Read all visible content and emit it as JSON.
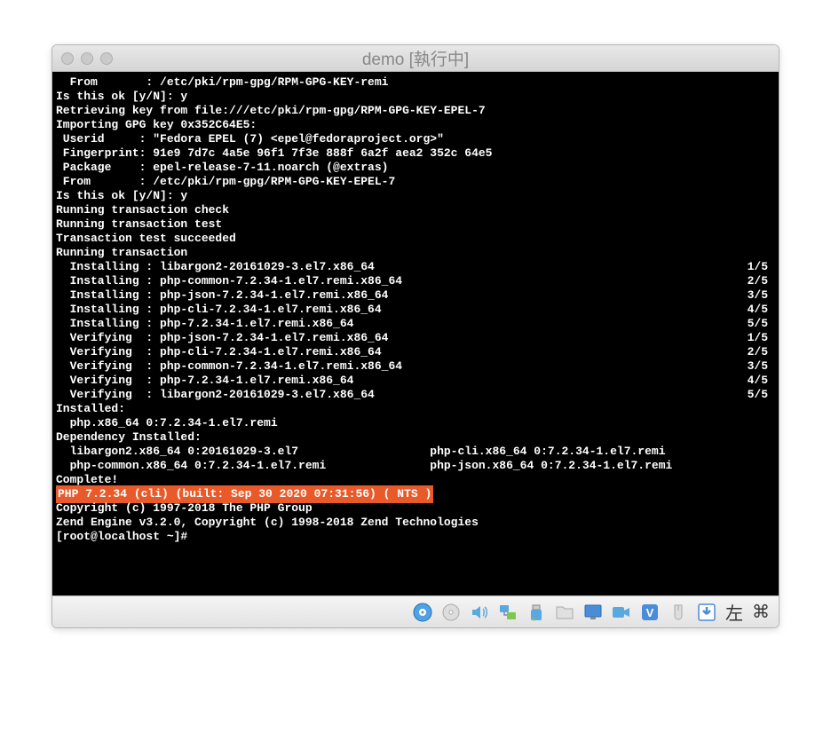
{
  "window": {
    "title": "demo [執行中]"
  },
  "terminal": {
    "lines": [
      {
        "left": "  From       : /etc/pki/rpm-gpg/RPM-GPG-KEY-remi",
        "right": ""
      },
      {
        "left": "Is this ok [y/N]: y",
        "right": ""
      },
      {
        "left": "Retrieving key from file:///etc/pki/rpm-gpg/RPM-GPG-KEY-EPEL-7",
        "right": ""
      },
      {
        "left": "Importing GPG key 0x352C64E5:",
        "right": ""
      },
      {
        "left": " Userid     : \"Fedora EPEL (7) <epel@fedoraproject.org>\"",
        "right": ""
      },
      {
        "left": " Fingerprint: 91e9 7d7c 4a5e 96f1 7f3e 888f 6a2f aea2 352c 64e5",
        "right": ""
      },
      {
        "left": " Package    : epel-release-7-11.noarch (@extras)",
        "right": ""
      },
      {
        "left": " From       : /etc/pki/rpm-gpg/RPM-GPG-KEY-EPEL-7",
        "right": ""
      },
      {
        "left": "Is this ok [y/N]: y",
        "right": ""
      },
      {
        "left": "Running transaction check",
        "right": ""
      },
      {
        "left": "Running transaction test",
        "right": ""
      },
      {
        "left": "Transaction test succeeded",
        "right": ""
      },
      {
        "left": "Running transaction",
        "right": ""
      },
      {
        "left": "  Installing : libargon2-20161029-3.el7.x86_64",
        "right": "1/5"
      },
      {
        "left": "  Installing : php-common-7.2.34-1.el7.remi.x86_64",
        "right": "2/5"
      },
      {
        "left": "  Installing : php-json-7.2.34-1.el7.remi.x86_64",
        "right": "3/5"
      },
      {
        "left": "  Installing : php-cli-7.2.34-1.el7.remi.x86_64",
        "right": "4/5"
      },
      {
        "left": "  Installing : php-7.2.34-1.el7.remi.x86_64",
        "right": "5/5"
      },
      {
        "left": "  Verifying  : php-json-7.2.34-1.el7.remi.x86_64",
        "right": "1/5"
      },
      {
        "left": "  Verifying  : php-cli-7.2.34-1.el7.remi.x86_64",
        "right": "2/5"
      },
      {
        "left": "  Verifying  : php-common-7.2.34-1.el7.remi.x86_64",
        "right": "3/5"
      },
      {
        "left": "  Verifying  : php-7.2.34-1.el7.remi.x86_64",
        "right": "4/5"
      },
      {
        "left": "  Verifying  : libargon2-20161029-3.el7.x86_64",
        "right": "5/5"
      },
      {
        "left": "",
        "right": ""
      },
      {
        "left": "Installed:",
        "right": ""
      },
      {
        "left": "  php.x86_64 0:7.2.34-1.el7.remi",
        "right": ""
      },
      {
        "left": "",
        "right": ""
      },
      {
        "left": "Dependency Installed:",
        "right": ""
      },
      {
        "left": "  libargon2.x86_64 0:20161029-3.el7                   php-cli.x86_64 0:7.2.34-1.el7.remi",
        "right": ""
      },
      {
        "left": "  php-common.x86_64 0:7.2.34-1.el7.remi               php-json.x86_64 0:7.2.34-1.el7.remi",
        "right": ""
      },
      {
        "left": "",
        "right": ""
      },
      {
        "left": "Complete!",
        "right": ""
      }
    ],
    "highlight_line": "PHP 7.2.34 (cli) (built: Sep 30 2020 07:31:56) ( NTS )",
    "after_highlight": [
      "Copyright (c) 1997-2018 The PHP Group",
      "Zend Engine v3.2.0, Copyright (c) 1998-2018 Zend Technologies",
      "[root@localhost ~]#"
    ]
  },
  "toolbar": {
    "left_label": "左"
  }
}
